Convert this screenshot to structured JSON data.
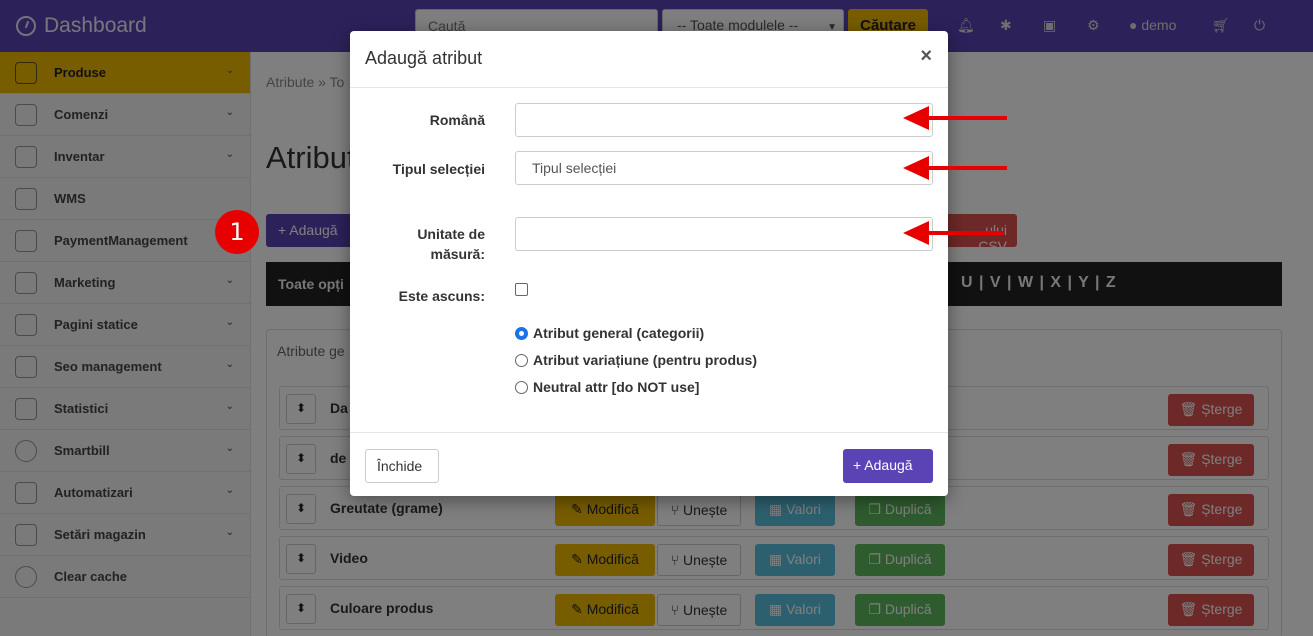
{
  "topbar": {
    "brand": "Dashboard",
    "search_placeholder": "Caută",
    "module_select": "-- Toate modulele --",
    "search_button": "Căutare",
    "user": "demo"
  },
  "sidebar": {
    "items": [
      {
        "label": "Produse",
        "active": true,
        "has_chevron": true
      },
      {
        "label": "Comenzi",
        "has_chevron": true
      },
      {
        "label": "Inventar",
        "has_chevron": true
      },
      {
        "label": "WMS",
        "has_chevron": false
      },
      {
        "label": "PaymentManagement",
        "has_chevron": false
      },
      {
        "label": "Marketing",
        "has_chevron": true
      },
      {
        "label": "Pagini statice",
        "has_chevron": true
      },
      {
        "label": "Seo management",
        "has_chevron": true
      },
      {
        "label": "Statistici",
        "has_chevron": true
      },
      {
        "label": "Smartbill",
        "has_chevron": true
      },
      {
        "label": "Automatizari",
        "has_chevron": true
      },
      {
        "label": "Setări magazin",
        "has_chevron": true
      },
      {
        "label": "Clear cache",
        "has_chevron": false
      }
    ]
  },
  "main": {
    "breadcrumb": "Atribute » To",
    "title": "Atribut",
    "add_button": "+ Adaugă",
    "csv_button": "ului CSV",
    "filter_label": "Toate opți",
    "letters": "U | V | W | X | Y | Z",
    "tab": "Atribute ge",
    "rows": [
      {
        "name": "Da"
      },
      {
        "name": "de"
      },
      {
        "name": "Greutate (grame)"
      },
      {
        "name": "Video"
      },
      {
        "name": "Culoare produs"
      }
    ],
    "row_buttons": {
      "modify": "Modifică",
      "merge": "Unește",
      "values": "Valori",
      "duplicate": "Duplică",
      "delete": "Șterge"
    }
  },
  "badge": "1",
  "modal": {
    "title": "Adaugă atribut",
    "close_x": "×",
    "fields": {
      "romana_label": "Română",
      "romana_value": "",
      "tip_label": "Tipul selecției",
      "tip_value": "Tipul selecției",
      "unitate_label_1": "Unitate de",
      "unitate_label_2": "măsură:",
      "unitate_value": "",
      "ascuns_label": "Este ascuns:",
      "ascuns_checked": false
    },
    "radios": [
      {
        "label": "Atribut general (categorii)",
        "checked": true
      },
      {
        "label": "Atribut variațiune (pentru produs)",
        "checked": false
      },
      {
        "label": "Neutral attr [do NOT use]",
        "checked": false
      }
    ],
    "close_button": "Închide",
    "add_button": "+ Adaugă"
  },
  "colors": {
    "primary": "#5b43b5",
    "accent": "#f0b800",
    "danger": "#d9534f",
    "annotation": "#e60000"
  }
}
